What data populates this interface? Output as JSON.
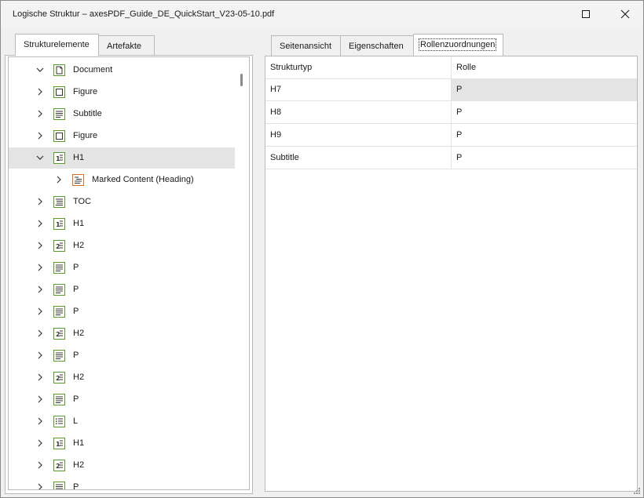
{
  "window": {
    "title": "Logische Struktur – axesPDF_Guide_DE_QuickStart_V23-05-10.pdf"
  },
  "left_tabs": [
    "Strukturelemente",
    "Artefakte"
  ],
  "right_tabs": [
    "Seitenansicht",
    "Eigenschaften",
    "Rollenzuordnungen"
  ],
  "tree": {
    "items": [
      {
        "label": "Document",
        "icon": "document-icon",
        "chevron": "expanded"
      },
      {
        "label": "Figure",
        "icon": "figure-icon",
        "chevron": "collapsed"
      },
      {
        "label": "Subtitle",
        "icon": "paragraph-icon",
        "chevron": "collapsed"
      },
      {
        "label": "Figure",
        "icon": "figure-icon",
        "chevron": "collapsed"
      },
      {
        "label": "H1",
        "icon": "heading-1-icon",
        "chevron": "expanded"
      },
      {
        "label": "Marked Content (Heading)",
        "icon": "marked-content-icon",
        "chevron": "collapsed"
      },
      {
        "label": "TOC",
        "icon": "toc-icon",
        "chevron": "collapsed"
      },
      {
        "label": "H1",
        "icon": "heading-1-icon",
        "chevron": "collapsed"
      },
      {
        "label": "H2",
        "icon": "heading-2-icon",
        "chevron": "collapsed"
      },
      {
        "label": "P",
        "icon": "paragraph-icon",
        "chevron": "collapsed"
      },
      {
        "label": "P",
        "icon": "paragraph-icon",
        "chevron": "collapsed"
      },
      {
        "label": "P",
        "icon": "paragraph-icon",
        "chevron": "collapsed"
      },
      {
        "label": "H2",
        "icon": "heading-2-icon",
        "chevron": "collapsed"
      },
      {
        "label": "P",
        "icon": "paragraph-icon",
        "chevron": "collapsed"
      },
      {
        "label": "H2",
        "icon": "heading-2-icon",
        "chevron": "collapsed"
      },
      {
        "label": "P",
        "icon": "paragraph-icon",
        "chevron": "collapsed"
      },
      {
        "label": "L",
        "icon": "list-icon",
        "chevron": "collapsed"
      },
      {
        "label": "H1",
        "icon": "heading-1-icon",
        "chevron": "collapsed"
      },
      {
        "label": "H2",
        "icon": "heading-2-icon",
        "chevron": "collapsed"
      },
      {
        "label": "P",
        "icon": "paragraph-icon",
        "chevron": "collapsed"
      }
    ]
  },
  "role_table": {
    "headers": [
      "Strukturtyp",
      "Rolle"
    ],
    "rows": [
      [
        "H7",
        "P"
      ],
      [
        "H8",
        "P"
      ],
      [
        "H9",
        "P"
      ],
      [
        "Subtitle",
        "P"
      ]
    ]
  },
  "colors": {
    "icon_green": "#5a9a2a",
    "icon_orange": "#e07020",
    "selection": "#e4e4e4"
  }
}
